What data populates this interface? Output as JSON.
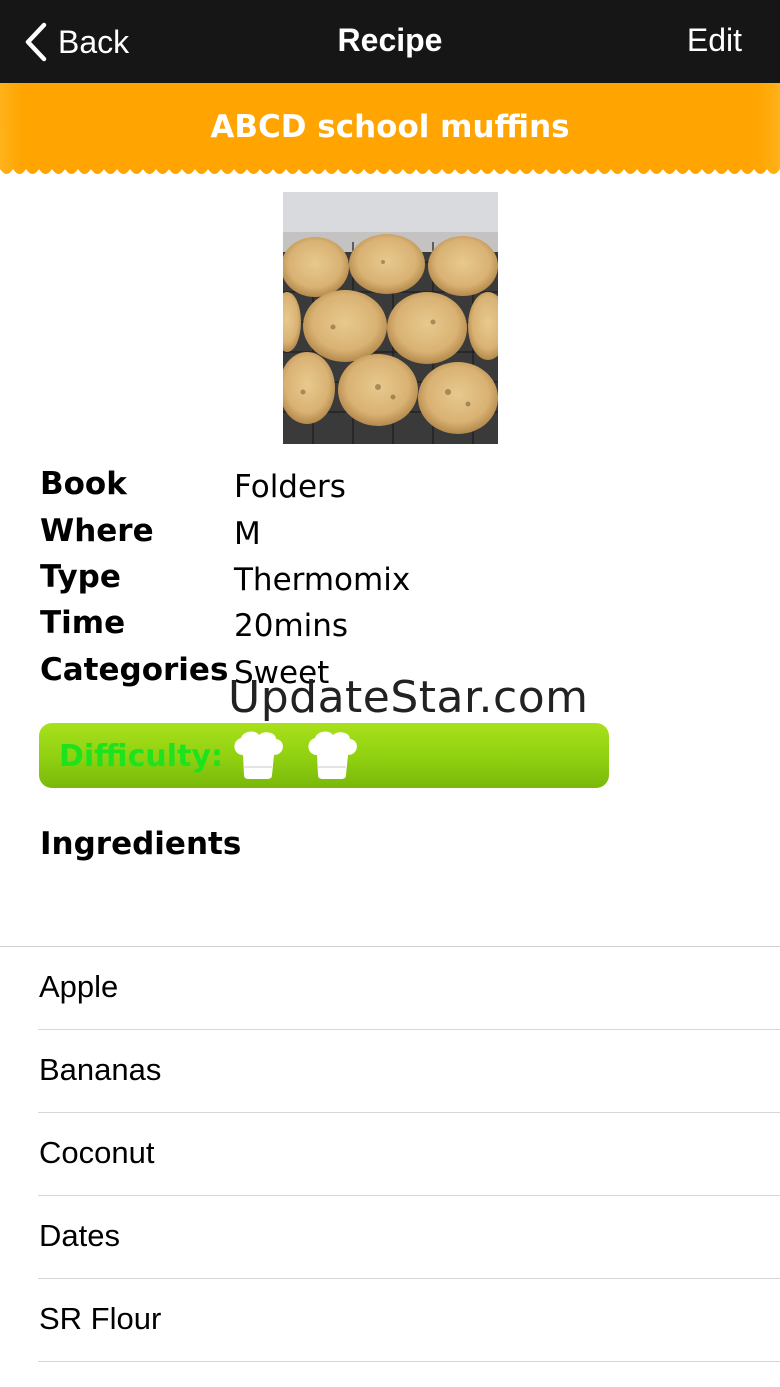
{
  "navbar": {
    "back_label": "Back",
    "title": "Recipe",
    "edit_label": "Edit"
  },
  "recipe": {
    "title": "ABCD school muffins",
    "banner_color": "#ffa400",
    "details": [
      {
        "label": "Book",
        "value": "Folders"
      },
      {
        "label": "Where",
        "value": "M"
      },
      {
        "label": "Type",
        "value": "Thermomix"
      },
      {
        "label": "Time",
        "value": "20mins"
      },
      {
        "label": "Categories",
        "value": "Sweet"
      }
    ],
    "difficulty": {
      "label": "Difficulty:",
      "hat_count": 2,
      "icon": "chef-hat-icon"
    }
  },
  "watermark": "UpdateStar.com",
  "ingredients": {
    "heading": "Ingredients",
    "items": [
      "Apple",
      "Bananas",
      "Coconut",
      "Dates",
      "SR Flour"
    ]
  }
}
